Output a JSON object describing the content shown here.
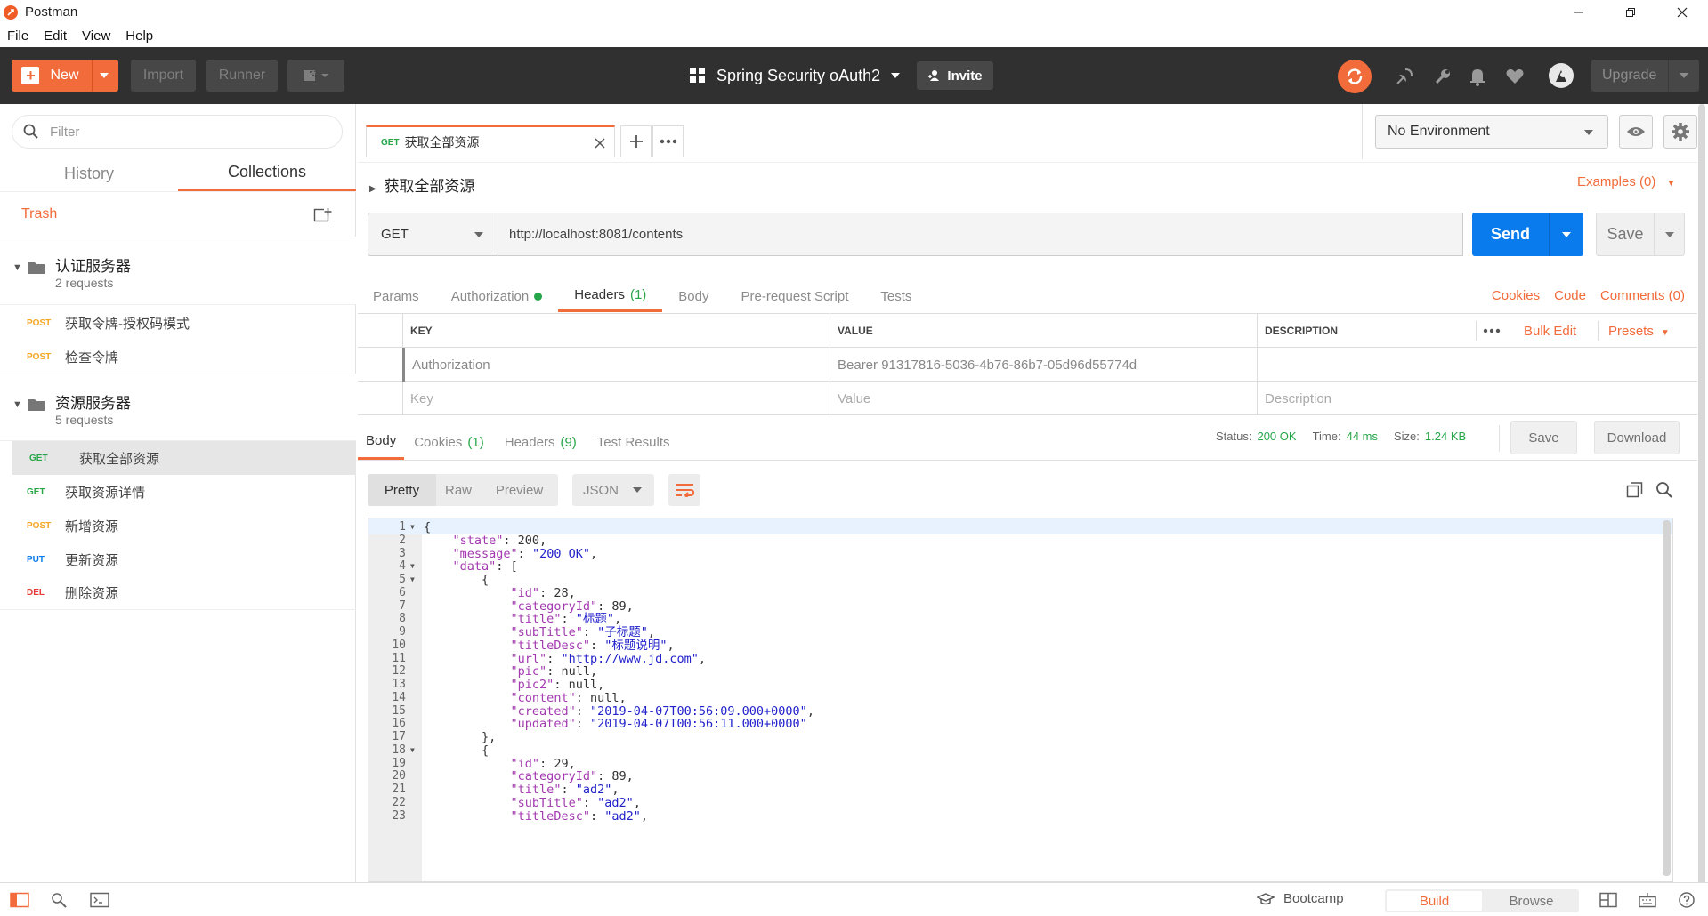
{
  "window": {
    "title": "Postman"
  },
  "menu": [
    "File",
    "Edit",
    "View",
    "Help"
  ],
  "header": {
    "new_label": "New",
    "import_label": "Import",
    "runner_label": "Runner",
    "workspace": "Spring Security oAuth2",
    "invite_label": "Invite",
    "upgrade_label": "Upgrade"
  },
  "sidebar": {
    "filter_placeholder": "Filter",
    "tabs": [
      "History",
      "Collections"
    ],
    "trash_label": "Trash",
    "folders": [
      {
        "name": "认证服务器",
        "count": "2 requests",
        "requests": [
          {
            "method": "POST",
            "name": "获取令牌-授权码模式"
          },
          {
            "method": "POST",
            "name": "检查令牌"
          }
        ]
      },
      {
        "name": "资源服务器",
        "count": "5 requests",
        "requests": [
          {
            "method": "GET",
            "name": "获取全部资源"
          },
          {
            "method": "GET",
            "name": "获取资源详情"
          },
          {
            "method": "POST",
            "name": "新增资源"
          },
          {
            "method": "PUT",
            "name": "更新资源"
          },
          {
            "method": "DEL",
            "name": "删除资源"
          }
        ]
      }
    ]
  },
  "tab": {
    "method": "GET",
    "name": "获取全部资源"
  },
  "environment": "No Environment",
  "request": {
    "title": "获取全部资源",
    "examples": "Examples (0)",
    "method": "GET",
    "url": "http://localhost:8081/contents",
    "send_label": "Send",
    "save_label": "Save",
    "tabs": [
      "Params",
      "Authorization",
      "Headers",
      "Body",
      "Pre-request Script",
      "Tests"
    ],
    "headers_count": "(1)",
    "links": [
      "Cookies",
      "Code",
      "Comments (0)"
    ],
    "table": {
      "columns": [
        "KEY",
        "VALUE",
        "DESCRIPTION"
      ],
      "bulk_edit": "Bulk Edit",
      "presets": "Presets",
      "rows": [
        {
          "key": "Authorization",
          "value": "Bearer 91317816-5036-4b76-86b7-05d96d55774d",
          "description": ""
        }
      ],
      "placeholder": {
        "key": "Key",
        "value": "Value",
        "description": "Description"
      }
    }
  },
  "response": {
    "tabs": [
      "Body",
      "Cookies",
      "Headers",
      "Test Results"
    ],
    "cookies_count": "(1)",
    "headers_count": "(9)",
    "status_label": "Status:",
    "status": "200 OK",
    "time_label": "Time:",
    "time": "44 ms",
    "size_label": "Size:",
    "size": "1.24 KB",
    "save_label": "Save",
    "download_label": "Download",
    "formats": [
      "Pretty",
      "Raw",
      "Preview"
    ],
    "language": "JSON",
    "lines": [
      "{",
      "    \"state\": 200,",
      "    \"message\": \"200 OK\",",
      "    \"data\": [",
      "        {",
      "            \"id\": 28,",
      "            \"categoryId\": 89,",
      "            \"title\": \"标题\",",
      "            \"subTitle\": \"子标题\",",
      "            \"titleDesc\": \"标题说明\",",
      "            \"url\": \"http://www.jd.com\",",
      "            \"pic\": null,",
      "            \"pic2\": null,",
      "            \"content\": null,",
      "            \"created\": \"2019-04-07T00:56:09.000+0000\",",
      "            \"updated\": \"2019-04-07T00:56:11.000+0000\"",
      "        },",
      "        {",
      "            \"id\": 29,",
      "            \"categoryId\": 89,",
      "            \"title\": \"ad2\",",
      "            \"subTitle\": \"ad2\",",
      "            \"titleDesc\": \"ad2\","
    ],
    "fold_lines": [
      1,
      4,
      5,
      18
    ]
  },
  "statusbar": {
    "bootcamp_label": "Bootcamp",
    "build_label": "Build",
    "browse_label": "Browse"
  },
  "colors": {
    "accent": "#f26b3a",
    "send": "#097bed",
    "get": "#27a649",
    "post": "#f5a623",
    "put": "#097bed",
    "del": "#e53935",
    "status_ok": "#27a649"
  }
}
